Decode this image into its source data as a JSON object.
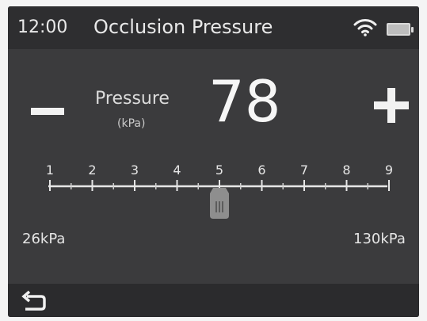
{
  "status_bar": {
    "time": "12:00",
    "title": "Occlusion Pressure",
    "icons": [
      "wifi-icon",
      "battery-icon"
    ]
  },
  "pressure": {
    "label": "Pressure",
    "unit": "(kPa)",
    "value": "78"
  },
  "controls": {
    "decrease_icon": "minus-icon",
    "increase_icon": "plus-icon"
  },
  "scale": {
    "ticks": [
      "1",
      "2",
      "3",
      "4",
      "5",
      "6",
      "7",
      "8",
      "9"
    ],
    "current_level": 5,
    "min_label": "26kPa",
    "max_label": "130kPa"
  },
  "footer": {
    "back_icon": "back-arrow-icon"
  },
  "colors": {
    "screen_background": "#3b3b3d",
    "bar_background": "#2e2e30",
    "text": "#e8e8e8",
    "slider_handle": "#8e8e8e"
  }
}
